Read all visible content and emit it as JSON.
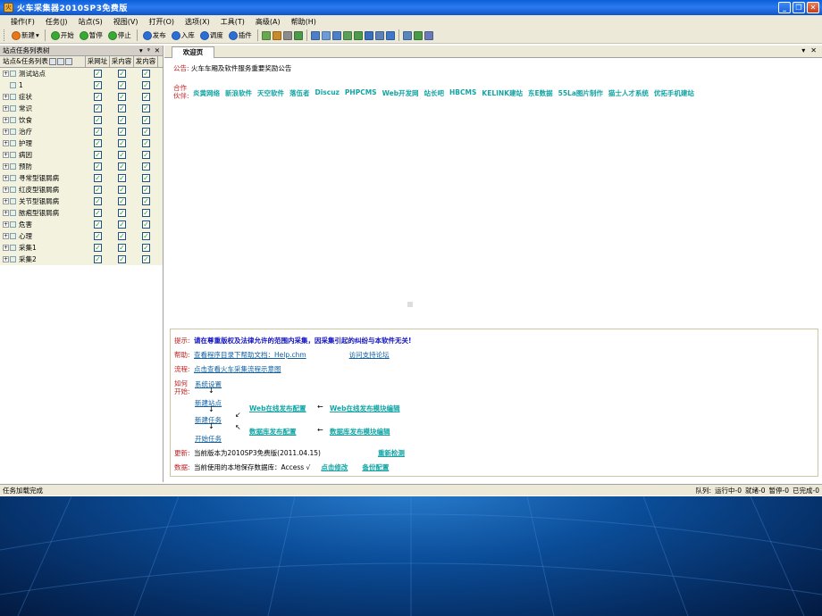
{
  "window": {
    "title": "火车采集器2010SP3免费版"
  },
  "menu": [
    "操作(F)",
    "任务(J)",
    "站点(S)",
    "视图(V)",
    "打开(O)",
    "选项(X)",
    "工具(T)",
    "高级(A)",
    "帮助(H)"
  ],
  "toolbar": {
    "buttons": [
      {
        "label": "新建",
        "icon": "new-icon",
        "color": "#e8761a"
      },
      {
        "label": "开始",
        "icon": "play-icon",
        "color": "#3aa835"
      },
      {
        "label": "暂停",
        "icon": "pause-icon",
        "color": "#3aa835"
      },
      {
        "label": "停止",
        "icon": "stop-icon",
        "color": "#3aa835"
      },
      {
        "label": "发布",
        "icon": "publish-icon",
        "color": "#2b6fd6"
      },
      {
        "label": "入库",
        "icon": "import-icon",
        "color": "#2b6fd6"
      },
      {
        "label": "调度",
        "icon": "schedule-icon",
        "color": "#2b6fd6"
      },
      {
        "label": "插件",
        "icon": "plugin-icon",
        "color": "#2b6fd6"
      }
    ]
  },
  "left_panel": {
    "title": "站点任务列表树",
    "controls": [
      "▾",
      "ᵠ",
      "✕"
    ],
    "columns": [
      "站点&任务列表",
      "采网址",
      "采内容",
      "发内容"
    ],
    "rows": [
      {
        "name": "测试站点",
        "expand": "+"
      },
      {
        "name": "1",
        "expand": ""
      },
      {
        "name": "症状",
        "expand": "+"
      },
      {
        "name": "常识",
        "expand": "+"
      },
      {
        "name": "饮食",
        "expand": "+"
      },
      {
        "name": "治疗",
        "expand": "+"
      },
      {
        "name": "护理",
        "expand": "+"
      },
      {
        "name": "病因",
        "expand": "+"
      },
      {
        "name": "预防",
        "expand": "+"
      },
      {
        "name": "寻常型银屑病",
        "expand": "+"
      },
      {
        "name": "红皮型银屑病",
        "expand": "+"
      },
      {
        "name": "关节型银屑病",
        "expand": "+"
      },
      {
        "name": "脓疱型银屑病",
        "expand": "+"
      },
      {
        "name": "危害",
        "expand": "+"
      },
      {
        "name": "心理",
        "expand": "+"
      },
      {
        "name": "采集1",
        "expand": "+"
      },
      {
        "name": "采集2",
        "expand": "+"
      }
    ],
    "check_mark": "✓"
  },
  "tab": {
    "label": "欢迎页",
    "controls": [
      "▾",
      "✕"
    ]
  },
  "welcome": {
    "notice_label": "公告:",
    "notice_text": "火车车厢及软件服务重要奖励公告",
    "partners_label": "合作\n伙伴:",
    "partners": [
      "炎黄网络",
      "新浪软件",
      "天空软件",
      "落伍者",
      "Discuz",
      "PHPCMS",
      "Web开发网",
      "站长吧",
      "HBCMS",
      "KELINK建站",
      "东E数据",
      "55La图片制作",
      "猫士人才系统",
      "优拓手机建站"
    ],
    "tip_label": "提示:",
    "tip_text": "请在尊重版权及法律允许的范围内采集，因采集引起的纠纷与本软件无关!",
    "help_label": "帮助:",
    "help_link": "查看程序目录下帮助文档：Help.chm",
    "forum_link": "访问支持论坛",
    "flow_label": "流程:",
    "flow_link": "点击查看火车采集流程示意图",
    "howto_label": "如何\n开始:",
    "step_system": "系统设置",
    "step_new_site": "新建站点",
    "step_new_task": "新建任务",
    "step_start": "开始任务",
    "web_publish_config": "Web在线发布配置",
    "web_publish_edit": "Web在线发布模块编辑",
    "db_publish_config": "数据库发布配置",
    "db_publish_edit": "数据库发布模块编辑",
    "update_label": "更新:",
    "update_text": "当前版本为2010SP3免费版(2011.04.15)",
    "recheck_link": "重新检测",
    "data_label": "数据:",
    "data_text": "当前使用的本地保存数据库：Access √",
    "modify_link": "点击修改",
    "backup_link": "备份配置"
  },
  "status": {
    "left": "任务加载完成",
    "queue_label": "队列:",
    "running": "运行中-0",
    "ready": "就绪-0",
    "paused": "暂停-0",
    "done": "已完成-0"
  }
}
